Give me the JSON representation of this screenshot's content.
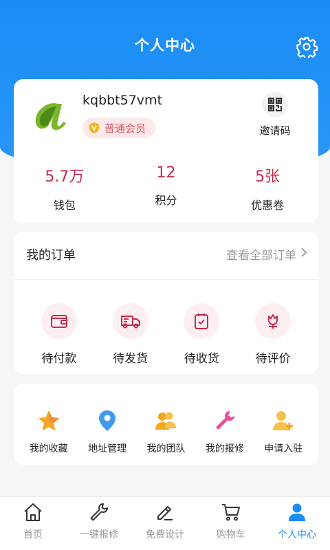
{
  "header": {
    "title": "个人中心",
    "settings_icon": "gear-icon"
  },
  "profile": {
    "username": "kqbbt57vmt",
    "member_level": "普通会员",
    "invite_label": "邀请码",
    "stats": [
      {
        "value": "5.7万",
        "label": "钱包"
      },
      {
        "value": "12",
        "label": "积分"
      },
      {
        "value": "5张",
        "label": "优惠卷"
      }
    ]
  },
  "orders": {
    "title": "我的订单",
    "view_all": "查看全部订单",
    "items": [
      {
        "label": "待付款",
        "icon": "wallet-icon"
      },
      {
        "label": "待发货",
        "icon": "truck-icon"
      },
      {
        "label": "待收货",
        "icon": "clipboard-check-icon"
      },
      {
        "label": "待评价",
        "icon": "flower-icon"
      }
    ]
  },
  "tools": {
    "items": [
      {
        "label": "我的收藏",
        "icon": "star-icon"
      },
      {
        "label": "地址管理",
        "icon": "location-pin-icon"
      },
      {
        "label": "我的团队",
        "icon": "team-icon"
      },
      {
        "label": "我的报修",
        "icon": "wrench-icon"
      },
      {
        "label": "申请入驻",
        "icon": "user-add-icon"
      }
    ]
  },
  "tabbar": {
    "active_index": 4,
    "items": [
      {
        "label": "首页",
        "icon": "home-icon"
      },
      {
        "label": "一键报修",
        "icon": "wrench-icon"
      },
      {
        "label": "免费设计",
        "icon": "pencil-icon"
      },
      {
        "label": "购物车",
        "icon": "cart-icon"
      },
      {
        "label": "个人中心",
        "icon": "user-icon"
      }
    ]
  },
  "colors": {
    "primary": "#1a8cf5",
    "accent": "#c8294a",
    "badge_bg": "#fde8ea",
    "badge_text": "#d65d6b"
  }
}
